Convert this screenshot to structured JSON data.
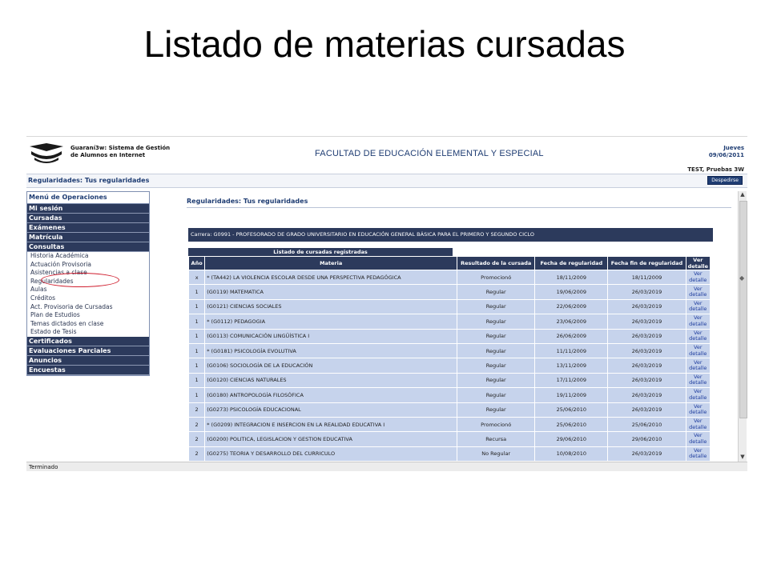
{
  "slide": {
    "title": "Listado de materias cursadas"
  },
  "header": {
    "app_line1": "Guaraní3w: Sistema de Gestión",
    "app_line2": "de Alumnos en Internet",
    "faculty": "FACULTAD DE EDUCACIÓN ELEMENTAL Y ESPECIAL",
    "day": "Jueves",
    "date": "09/06/2011",
    "user": "TEST, Pruebas 3W",
    "logout_label": "Despedirse"
  },
  "page_bar": {
    "title": "Regularidades: Tus regularidades"
  },
  "menu": {
    "title": "Menú de Operaciones",
    "top_items": [
      "Mi sesión",
      "Cursadas",
      "Exámenes",
      "Matrícula",
      "Consultas"
    ],
    "sub_items": [
      "Historia Académica",
      "Actuación Provisoria",
      "Asistencias a clase",
      "Regularidades",
      "Aulas",
      "Créditos",
      "Act. Provisoria de Cursadas",
      "Plan de Estudios",
      "Temas dictados en clase",
      "Estado de Tesis"
    ],
    "bottom_items": [
      "Certificados",
      "Evaluaciones Parciales",
      "Anuncios",
      "Encuestas"
    ],
    "highlighted": "Regularidades"
  },
  "content": {
    "title": "Regularidades: Tus regularidades",
    "career": "Carrera: G0991 - PROFESORADO DE GRADO UNIVERSITARIO EN EDUCACIÓN GENERAL BÁSICA PARA EL PRIMERO Y SEGUNDO CICLO",
    "table_caption": "Listado de cursadas registradas",
    "columns": [
      "Año",
      "Materia",
      "Resultado de la cursada",
      "Fecha de regularidad",
      "Fecha fin de regularidad",
      "Ver detalle"
    ],
    "link_line1": "Ver",
    "link_line2": "detalle",
    "rows": [
      {
        "year": "x",
        "subject": "* (TA442) LA VIOLENCIA ESCOLAR DESDE UNA PERSPECTIVA PEDAGÓGICA",
        "result": "Promocionó",
        "date": "18/11/2009",
        "end": "18/11/2009"
      },
      {
        "year": "1",
        "subject": "(G0119) MATEMATICA",
        "result": "Regular",
        "date": "19/06/2009",
        "end": "26/03/2019"
      },
      {
        "year": "1",
        "subject": "(G0121) CIENCIAS SOCIALES",
        "result": "Regular",
        "date": "22/06/2009",
        "end": "26/03/2019"
      },
      {
        "year": "1",
        "subject": "* (G0112) PEDAGOGIA",
        "result": "Regular",
        "date": "23/06/2009",
        "end": "26/03/2019"
      },
      {
        "year": "1",
        "subject": "(G0113) COMUNICACIÓN LINGÜÍSTICA I",
        "result": "Regular",
        "date": "26/06/2009",
        "end": "26/03/2019"
      },
      {
        "year": "1",
        "subject": "* (G0181) PSICOLOGÍA EVOLUTIVA",
        "result": "Regular",
        "date": "11/11/2009",
        "end": "26/03/2019"
      },
      {
        "year": "1",
        "subject": "(G0106) SOCIOLOGÍA DE LA EDUCACIÓN",
        "result": "Regular",
        "date": "13/11/2009",
        "end": "26/03/2019"
      },
      {
        "year": "1",
        "subject": "(G0120) CIENCIAS NATURALES",
        "result": "Regular",
        "date": "17/11/2009",
        "end": "26/03/2019"
      },
      {
        "year": "1",
        "subject": "(G0180) ANTROPOLOGÍA FILOSÓFICA",
        "result": "Regular",
        "date": "19/11/2009",
        "end": "26/03/2019"
      },
      {
        "year": "2",
        "subject": "(G0273) PSICOLOGÍA EDUCACIONAL",
        "result": "Regular",
        "date": "25/06/2010",
        "end": "26/03/2019"
      },
      {
        "year": "2",
        "subject": "* (G0209) INTEGRACION E INSERCION EN LA REALIDAD EDUCATIVA I",
        "result": "Promocionó",
        "date": "25/06/2010",
        "end": "25/06/2010"
      },
      {
        "year": "2",
        "subject": "(G0200) POLITICA, LEGISLACION Y GESTION EDUCATIVA",
        "result": "Recursa",
        "date": "29/06/2010",
        "end": "29/06/2010"
      },
      {
        "year": "2",
        "subject": "(G0275) TEORIA Y DESARROLLO DEL CURRICULO",
        "result": "No Regular",
        "date": "10/08/2010",
        "end": "26/03/2019"
      }
    ]
  },
  "status_bar": {
    "text": "Terminado"
  },
  "colors": {
    "navy": "#2c3a5c",
    "row_blue": "#c6d3ec",
    "accent": "#1f3d73",
    "highlight_circle": "#d02030"
  }
}
